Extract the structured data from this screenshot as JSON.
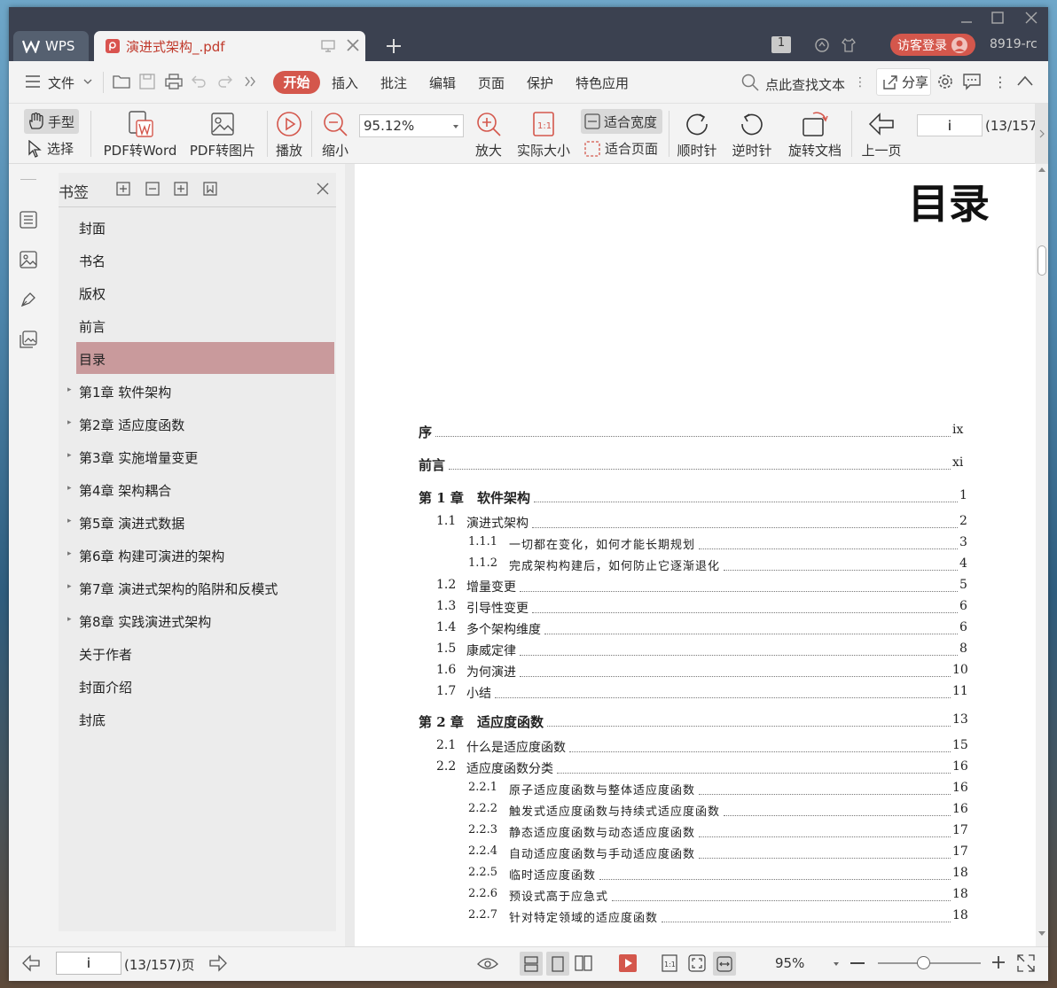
{
  "app": {
    "brand": "WPS",
    "doc_tab": "演进式架构_.pdf",
    "page_badge": "1",
    "login": "访客登录",
    "version": "8919-rc"
  },
  "menu": {
    "file": "文件",
    "items": [
      "开始",
      "插入",
      "批注",
      "编辑",
      "页面",
      "保护",
      "特色应用"
    ],
    "search": "点此查找文本",
    "share": "分享"
  },
  "ribbon": {
    "hand": "手型",
    "select": "选择",
    "pdf2word": "PDF转Word",
    "pdf2img": "PDF转图片",
    "play": "播放",
    "zoom_out": "缩小",
    "zoom_value": "95.12%",
    "zoom_in": "放大",
    "actual": "实际大小",
    "fit_width": "适合宽度",
    "fit_page": "适合页面",
    "cw": "顺时针",
    "ccw": "逆时针",
    "rotate": "旋转文档",
    "prev": "上一页",
    "page_input": "i",
    "page_total": "(13/157"
  },
  "bookmarks": {
    "title": "书签",
    "items": [
      {
        "label": "封面",
        "expandable": false
      },
      {
        "label": "书名",
        "expandable": false
      },
      {
        "label": "版权",
        "expandable": false
      },
      {
        "label": "前言",
        "expandable": false
      },
      {
        "label": "目录",
        "expandable": false,
        "selected": true
      },
      {
        "label": "第1章  软件架构",
        "expandable": true
      },
      {
        "label": "第2章  适应度函数",
        "expandable": true
      },
      {
        "label": "第3章  实施增量变更",
        "expandable": true
      },
      {
        "label": "第4章  架构耦合",
        "expandable": true
      },
      {
        "label": "第5章  演进式数据",
        "expandable": true
      },
      {
        "label": "第6章  构建可演进的架构",
        "expandable": true
      },
      {
        "label": "第7章  演进式架构的陷阱和反模式",
        "expandable": true
      },
      {
        "label": "第8章  实践演进式架构",
        "expandable": true
      },
      {
        "label": "关于作者",
        "expandable": false
      },
      {
        "label": "封面介绍",
        "expandable": false
      },
      {
        "label": "封底",
        "expandable": false
      }
    ]
  },
  "document": {
    "heading": "目录",
    "toc": [
      {
        "num": "序",
        "title": "",
        "page": "ix",
        "level": 0
      },
      {
        "num": "前言",
        "title": "",
        "page": "xi",
        "level": 0
      },
      {
        "num": "第 1 章",
        "title": "软件架构",
        "page": "1",
        "level": 0
      },
      {
        "num": "1.1",
        "title": "演进式架构",
        "page": "2",
        "level": 1
      },
      {
        "num": "1.1.1",
        "title": "一切都在变化，如何才能长期规划",
        "page": "3",
        "level": 2
      },
      {
        "num": "1.1.2",
        "title": "完成架构构建后，如何防止它逐渐退化",
        "page": "4",
        "level": 2
      },
      {
        "num": "1.2",
        "title": "增量变更",
        "page": "5",
        "level": 1
      },
      {
        "num": "1.3",
        "title": "引导性变更",
        "page": "6",
        "level": 1
      },
      {
        "num": "1.4",
        "title": "多个架构维度",
        "page": "6",
        "level": 1
      },
      {
        "num": "1.5",
        "title": "康威定律",
        "page": "8",
        "level": 1
      },
      {
        "num": "1.6",
        "title": "为何演进",
        "page": "10",
        "level": 1
      },
      {
        "num": "1.7",
        "title": "小结",
        "page": "11",
        "level": 1
      },
      {
        "num": "第 2 章",
        "title": "适应度函数",
        "page": "13",
        "level": 0
      },
      {
        "num": "2.1",
        "title": "什么是适应度函数",
        "page": "15",
        "level": 1
      },
      {
        "num": "2.2",
        "title": "适应度函数分类",
        "page": "16",
        "level": 1
      },
      {
        "num": "2.2.1",
        "title": "原子适应度函数与整体适应度函数",
        "page": "16",
        "level": 2
      },
      {
        "num": "2.2.2",
        "title": "触发式适应度函数与持续式适应度函数",
        "page": "16",
        "level": 2
      },
      {
        "num": "2.2.3",
        "title": "静态适应度函数与动态适应度函数",
        "page": "17",
        "level": 2
      },
      {
        "num": "2.2.4",
        "title": "自动适应度函数与手动适应度函数",
        "page": "17",
        "level": 2
      },
      {
        "num": "2.2.5",
        "title": "临时适应度函数",
        "page": "18",
        "level": 2
      },
      {
        "num": "2.2.6",
        "title": "预设式高于应急式",
        "page": "18",
        "level": 2
      },
      {
        "num": "2.2.7",
        "title": "针对特定领域的适应度函数",
        "page": "18",
        "level": 2
      }
    ]
  },
  "status": {
    "page_input": "i",
    "page_text": "(13/157)页",
    "zoom": "95%"
  }
}
